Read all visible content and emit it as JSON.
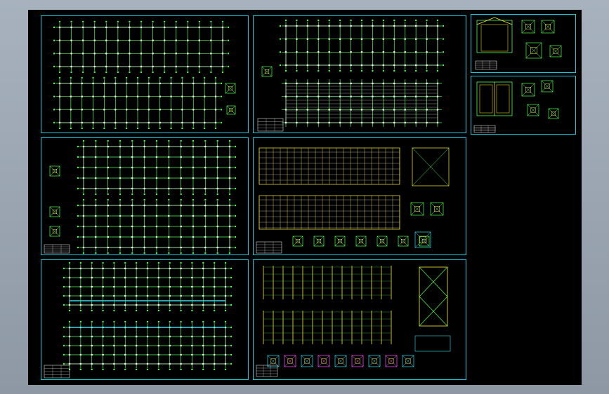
{
  "colors": {
    "background": "#000000",
    "sheet_border": "#19c8dc",
    "grid_line": "#4dff4d",
    "axis_line": "#ffffff",
    "accent_yellow": "#ffee33",
    "accent_cyan": "#33ddee",
    "accent_magenta": "#ff55ff"
  },
  "sheets": [
    {
      "id": "s1",
      "kind": "plan-pair"
    },
    {
      "id": "s2",
      "kind": "plan-pair-bracing"
    },
    {
      "id": "s3",
      "kind": "detail-top"
    },
    {
      "id": "s4",
      "kind": "plan-pair-details"
    },
    {
      "id": "s5",
      "kind": "elevations"
    },
    {
      "id": "s6",
      "kind": "detail-bottom"
    },
    {
      "id": "s7",
      "kind": "plan-pair-cyan"
    },
    {
      "id": "s8",
      "kind": "column-details"
    }
  ]
}
